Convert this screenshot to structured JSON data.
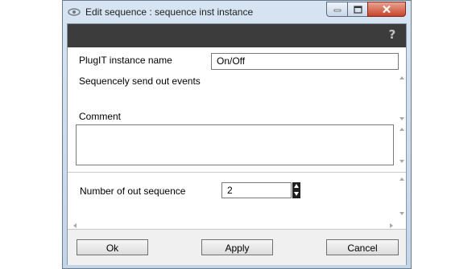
{
  "window": {
    "title": "Edit sequence : sequence inst instance",
    "app_icon": "eye-icon",
    "controls": {
      "minimize_icon": "minimize-icon",
      "maximize_icon": "maximize-icon",
      "close_icon": "close-icon"
    }
  },
  "toolbar": {
    "help_icon": "help-icon",
    "help_glyph": "?"
  },
  "form": {
    "name_label": "PlugIT instance name",
    "name_value": "On/Off",
    "description": "Sequencely send out events",
    "comment_label": "Comment",
    "comment_value": "",
    "out_sequence_label": "Number of out sequence",
    "out_sequence_value": "2"
  },
  "buttons": {
    "ok": "Ok",
    "apply": "Apply",
    "cancel": "Cancel"
  },
  "colors": {
    "toolbar_bg": "#3c3c3c",
    "close_button": "#c7442b",
    "client_bg": "#f0f0f0"
  }
}
